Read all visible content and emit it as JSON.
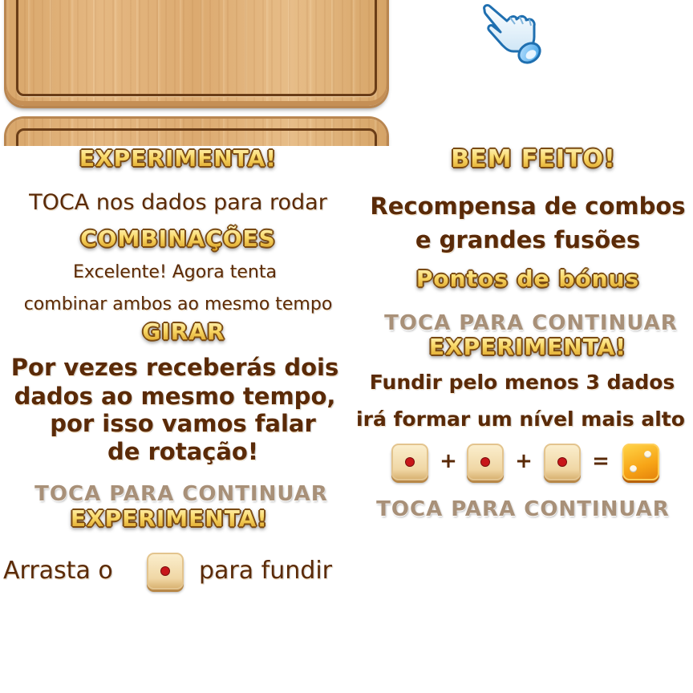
{
  "left": {
    "try_it_1": "EXPERIMENTA!",
    "tap_dice": "TOCA nos dados para rodar",
    "combinations_title": "COMBINAÇÕES",
    "combo_line1": "Excelente! Agora tenta",
    "combo_line2": "combinar ambos ao mesmo tempo",
    "rotate_title": "GIRAR",
    "rotate_line1": "Por vezes receberás dois",
    "rotate_line2": "dados ao mesmo tempo,",
    "rotate_line3": "por isso vamos falar",
    "rotate_line4": "de rotação!",
    "tap_continue": "TOCA PARA CONTINUAR",
    "try_it_2": "EXPERIMENTA!",
    "drag_prefix": "Arrasta o",
    "drag_suffix": "para fundir"
  },
  "right": {
    "well_done": "BEM FEITO!",
    "reward_line1": "Recompensa de combos",
    "reward_line2": "e grandes fusões",
    "bonus_title": "Pontos de bónus",
    "tap_continue_1": "TOCA PARA CONTINUAR",
    "try_it": "EXPERIMENTA!",
    "merge_line1": "Fundir pelo menos 3 dados",
    "merge_line2": "irá formar um nível mais alto",
    "plus": "+",
    "equals": "=",
    "tap_continue_2": "TOCA PARA CONTINUAR"
  },
  "icons": {
    "hand": "pointing-hand-icon",
    "die_one": "die-one-pip-icon",
    "die_two": "die-two-pips-icon"
  },
  "colors": {
    "gold": "#f1c24a",
    "brown_text": "#5a2a08",
    "grey_text": "#a89078",
    "wood": "#e0b078",
    "pip_red": "#c8161a",
    "die_orange": "#f7a416"
  }
}
